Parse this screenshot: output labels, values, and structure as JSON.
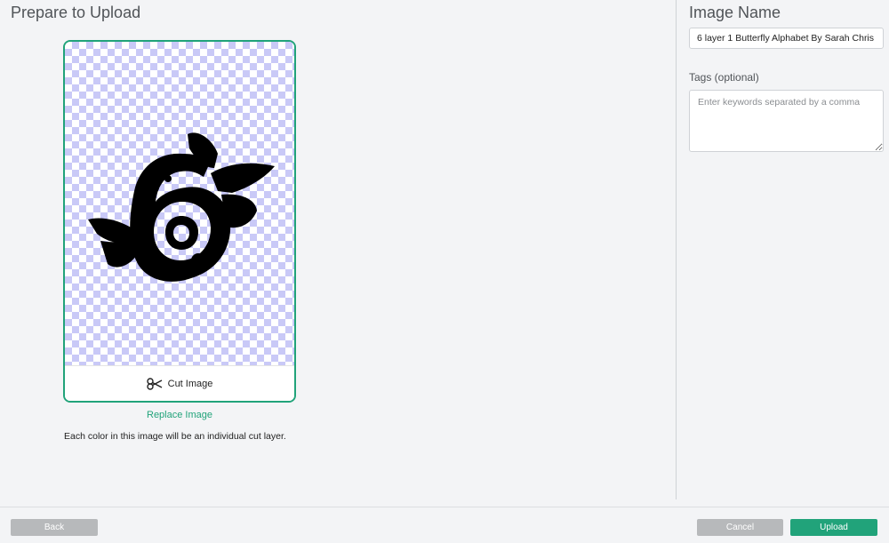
{
  "page": {
    "title": "Prepare to Upload"
  },
  "preview": {
    "cut_image_label": "Cut Image",
    "cut_icon": "scissors-icon",
    "replace_link": "Replace Image",
    "info_text": "Each color in this image will be an individual cut layer."
  },
  "details": {
    "image_name_title": "Image Name",
    "image_name_value": "6 layer 1 Butterfly Alphabet By Sarah Chris",
    "tags_label": "Tags (optional)",
    "tags_placeholder": "Enter keywords separated by a comma"
  },
  "footer": {
    "back_label": "Back",
    "cancel_label": "Cancel",
    "upload_label": "Upload"
  },
  "colors": {
    "accent": "#21a37a",
    "disabled_button": "#b7b9bb",
    "checker": "#c9c9f7"
  }
}
